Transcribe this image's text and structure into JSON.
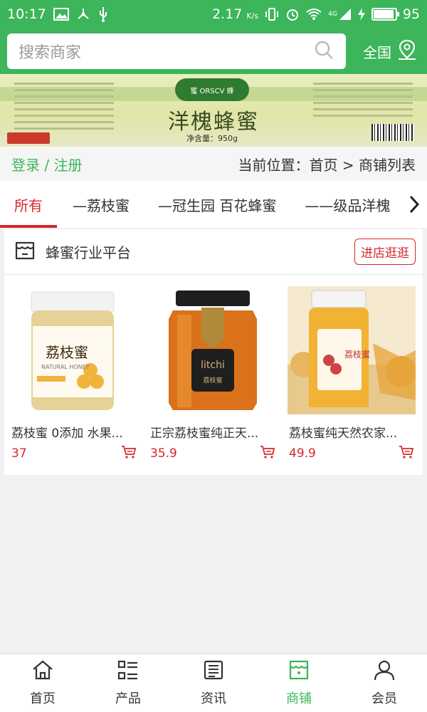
{
  "status_bar": {
    "time": "10:17",
    "speed": "2.17",
    "speed_unit": "K/s",
    "network": "4G",
    "battery": "95",
    "battery_level": 0.95
  },
  "header": {
    "search_placeholder": "搜索商家",
    "region": "全国"
  },
  "banner": {
    "logo_text": "蜜 ORSCV 蜂",
    "product_title": "洋槐蜂蜜",
    "net_weight": "净含量：950g"
  },
  "breadcrumb": {
    "login": "登录 / 注册",
    "location": "当前位置：首页 > 商铺列表"
  },
  "tabs": [
    {
      "label": "所有",
      "active": true
    },
    {
      "label": "—荔枝蜜",
      "active": false
    },
    {
      "label": "—冠生园 百花蜂蜜",
      "active": false
    },
    {
      "label": "——级品洋槐",
      "active": false
    }
  ],
  "shop": {
    "name": "蜂蜜行业平台",
    "visit_label": "进店逛逛"
  },
  "products": [
    {
      "title": "荔枝蜜 0添加 水果...",
      "price": "37",
      "jar_label": "荔枝蜜",
      "jar_sub": "NATURAL HONEY"
    },
    {
      "title": "正宗荔枝蜜纯正天...",
      "price": "35.9",
      "jar_label": "litchi",
      "jar_sub": "荔枝蜜"
    },
    {
      "title": "荔枝蜜纯天然农家...",
      "price": "49.9",
      "jar_label": "荔枝蜜",
      "jar_sub": ""
    }
  ],
  "bottom_nav": [
    {
      "label": "首页",
      "icon": "home-icon",
      "active": false
    },
    {
      "label": "产品",
      "icon": "list-icon",
      "active": false
    },
    {
      "label": "资讯",
      "icon": "news-icon",
      "active": false
    },
    {
      "label": "商铺",
      "icon": "store-icon",
      "active": true
    },
    {
      "label": "会员",
      "icon": "user-icon",
      "active": false
    }
  ],
  "colors": {
    "brand_green": "#3cb55b",
    "accent_red": "#d4282d"
  }
}
